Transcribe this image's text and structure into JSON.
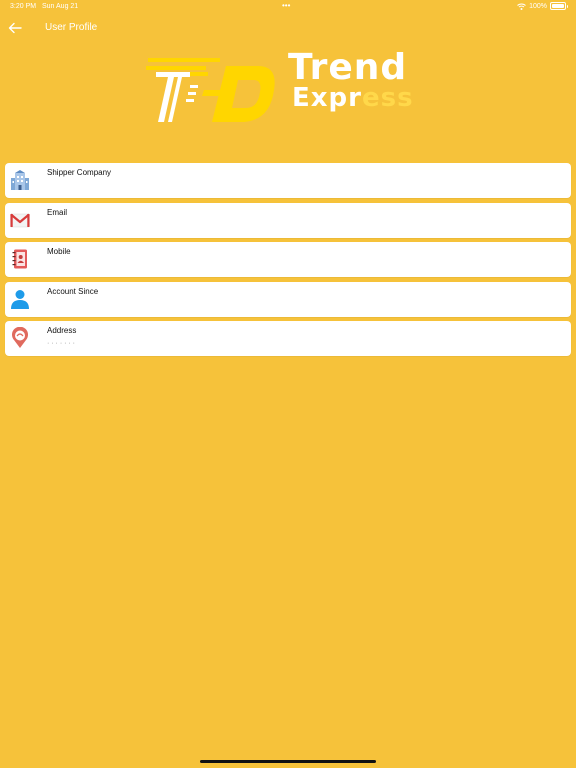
{
  "status": {
    "time": "3:20 PM",
    "date": "Sun Aug 21",
    "dots": "•••",
    "battery": "100%"
  },
  "nav": {
    "back_icon": "arrow-left-icon",
    "title": "User Profile"
  },
  "logo": {
    "line1": "Trend",
    "line2_main": "Expr",
    "line2_faint": "ess",
    "colors": {
      "accent": "#FFD600",
      "white": "#FFFFFF"
    }
  },
  "profile": {
    "items": [
      {
        "label": "Shipper Company",
        "value": "",
        "icon": "building-icon"
      },
      {
        "label": "Email",
        "value": "",
        "icon": "mail-icon"
      },
      {
        "label": "Mobile",
        "value": "",
        "icon": "contact-book-icon"
      },
      {
        "label": "Account Since",
        "value": "",
        "icon": "user-icon"
      },
      {
        "label": "Address",
        "value": "· · · · · · ·",
        "icon": "location-pin-icon"
      }
    ]
  },
  "colors": {
    "background": "#F6C23A",
    "card": "#FFFFFF"
  }
}
